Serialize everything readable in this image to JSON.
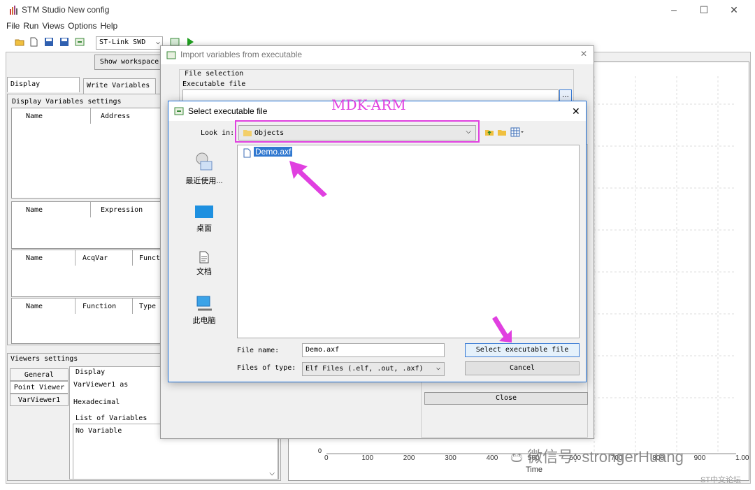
{
  "window": {
    "title": "STM Studio New config",
    "minimize": "–",
    "maximize": "☐",
    "close": "✕"
  },
  "menu": [
    "File",
    "Run",
    "Views",
    "Options",
    "Help"
  ],
  "toolbar": {
    "probe": "ST-Link SWD",
    "show_workspace": "Show workspace"
  },
  "left_panel": {
    "tabs": [
      "Display Variables",
      "Write Variables"
    ],
    "settings_label": "Display Variables settings",
    "grid1": [
      "Name",
      "Address"
    ],
    "grid2": [
      "Name",
      "Expression"
    ],
    "grid3": [
      "Name",
      "AcqVar",
      "Functi"
    ],
    "grid4": [
      "Name",
      "Function",
      "Type"
    ]
  },
  "viewers": {
    "label": "Viewers settings",
    "tabs": [
      "General",
      "Point Viewer",
      "VarViewer1"
    ],
    "display_label": "Display",
    "display_line": "VarViewer1 as",
    "format": "Hexadecimal",
    "list_label": "List of Variables",
    "list_value": "No Variable"
  },
  "chart": {
    "y_tick": "0",
    "x_ticks": [
      "0",
      "100",
      "200",
      "300",
      "400",
      "500",
      "600",
      "700",
      "800",
      "900",
      "1.00"
    ],
    "xlabel": "Time"
  },
  "import_dialog": {
    "title": "Import variables from executable",
    "file_selection": "File selection",
    "executable_file": "Executable file",
    "browse": "...",
    "close_button": "Close"
  },
  "file_dialog": {
    "title": "Select executable file",
    "look_in_label": "Look in:",
    "look_in_value": "Objects",
    "places": [
      "最近使用...",
      "桌面",
      "文档",
      "此电脑"
    ],
    "file": "Demo.axf",
    "file_name_label": "File name:",
    "file_name_value": "Demo.axf",
    "files_of_type_label": "Files of type:",
    "files_of_type_value": "Elf Files (.elf, .out, .axf)",
    "select_button": "Select executable file",
    "cancel_button": "Cancel"
  },
  "annotation": {
    "label": "MDK-ARM",
    "color": "#e040e0"
  },
  "watermark": {
    "text": "微信号: strongerHuang",
    "footer": "ST中文论坛"
  }
}
